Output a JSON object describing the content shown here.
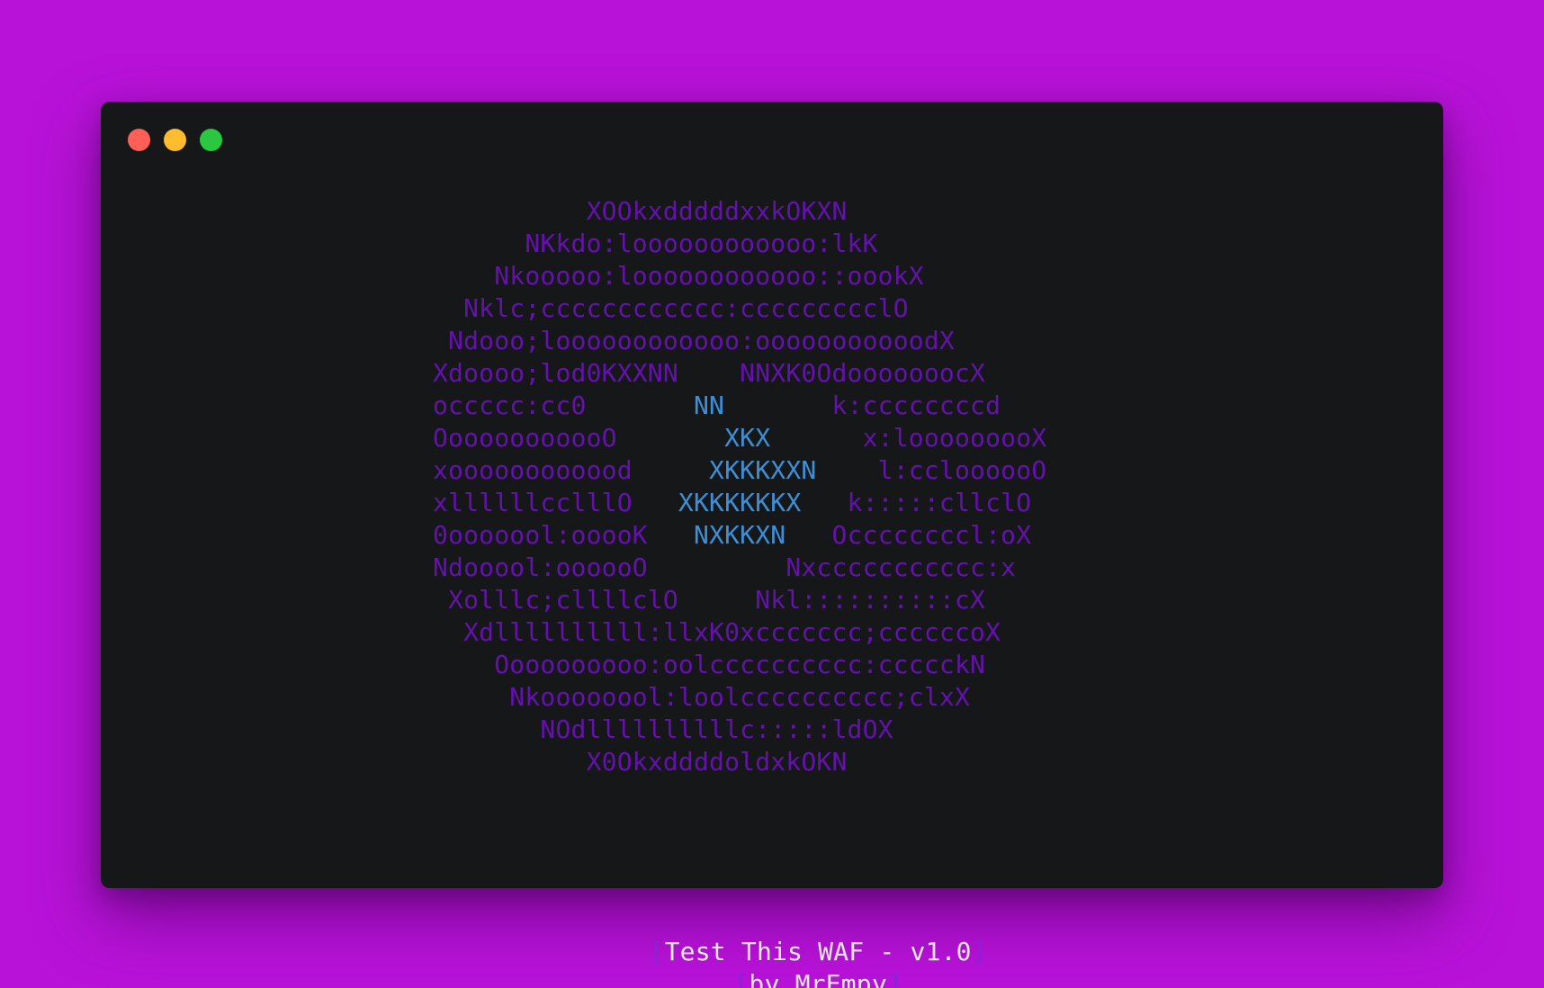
{
  "window": {
    "controls": [
      {
        "name": "close",
        "color": "#fe5f57"
      },
      {
        "name": "minimize",
        "color": "#febc2e"
      },
      {
        "name": "maximize",
        "color": "#29c840"
      }
    ]
  },
  "colors": {
    "background": "#b812d8",
    "terminal": "#161719",
    "art_outer": "#6411ad",
    "art_inner": "#3d8fd8",
    "bracket": "#8a22d6",
    "text": "#e8e8e8"
  },
  "ascii_art": [
    [
      {
        "t": "          XOOkxdddddxxkOKXN",
        "c": "o"
      }
    ],
    [
      {
        "t": "      NKkdo:loooooooooooo:lkK",
        "c": "o"
      }
    ],
    [
      {
        "t": "    Nkooooo:loooooooooooo::oookX",
        "c": "o"
      }
    ],
    [
      {
        "t": "  Nklc;cccccccccccc:ccccccccclO",
        "c": "o"
      }
    ],
    [
      {
        "t": " Ndooo;loooooooooooo:ooooooooooodX",
        "c": "o"
      }
    ],
    [
      {
        "t": "Xdoooo;lod0KXXNN    NNXK0OdooooooocX",
        "c": "o"
      }
    ],
    [
      {
        "t": "occccc:cc0       ",
        "c": "o"
      },
      {
        "t": "NN",
        "c": "i"
      },
      {
        "t": "       k:ccccccccd",
        "c": "o"
      }
    ],
    [
      {
        "t": "OooooooooooO       ",
        "c": "o"
      },
      {
        "t": "XKX",
        "c": "i"
      },
      {
        "t": "      x:looooooooX",
        "c": "o"
      }
    ],
    [
      {
        "t": "xoooooooooood     ",
        "c": "o"
      },
      {
        "t": "XKKKXXN",
        "c": "i"
      },
      {
        "t": "    l:ccloooooO",
        "c": "o"
      }
    ],
    [
      {
        "t": "xllllllcclllO   ",
        "c": "o"
      },
      {
        "t": "XKKKKKKX",
        "c": "i"
      },
      {
        "t": "   k:::::cllclO",
        "c": "o"
      }
    ],
    [
      {
        "t": "0ooooool:ooooK   ",
        "c": "o"
      },
      {
        "t": "NXKKXN",
        "c": "i"
      },
      {
        "t": "   Occccccccl:oX",
        "c": "o"
      }
    ],
    [
      {
        "t": "Ndooool:oooooO         Nxccccccccccc:x",
        "c": "o"
      }
    ],
    [
      {
        "t": " Xolllc;cllllclO     Nkl::::::::::cX",
        "c": "o"
      }
    ],
    [
      {
        "t": "  Xdllllllllll:llxK0xccccccc;ccccccoX",
        "c": "o"
      }
    ],
    [
      {
        "t": "    Oooooooooo:oolcccccccccc:ccccckN",
        "c": "o"
      }
    ],
    [
      {
        "t": "     Nkoooooool:loolcccccccccc;clxX",
        "c": "o"
      }
    ],
    [
      {
        "t": "       NOdllllllllllc:::::ldOX",
        "c": "o"
      }
    ],
    [
      {
        "t": "          X0OkxddddoldxkOKN",
        "c": "o"
      }
    ]
  ],
  "footer": {
    "open_bracket": "[",
    "close_bracket": "]",
    "title": "Test This WAF - v1.0",
    "author": "by MrEmpy"
  }
}
